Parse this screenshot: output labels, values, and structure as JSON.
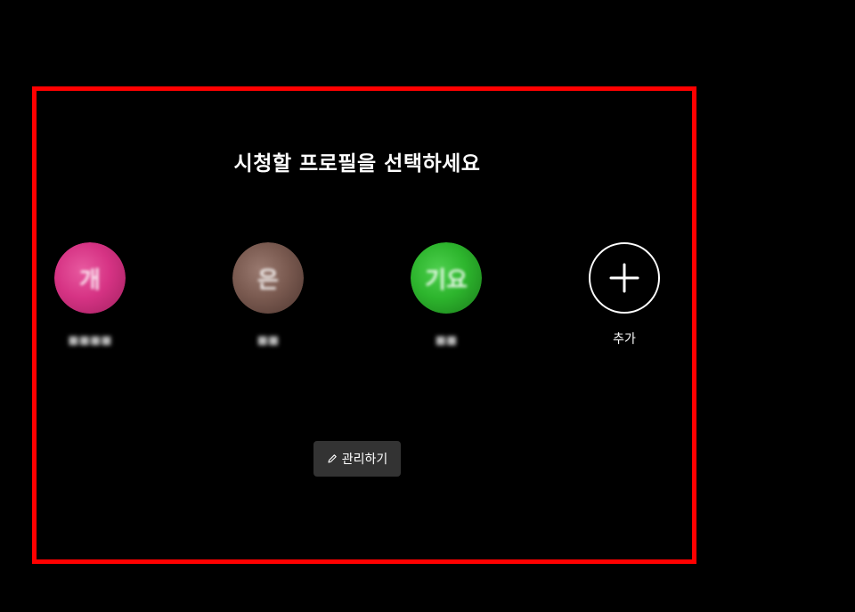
{
  "page": {
    "title": "시청할 프로필을 선택하세요"
  },
  "profiles": [
    {
      "name": "■■■■",
      "glyph": "개",
      "color": "#d63384",
      "color_dark": "#a0205f",
      "icon": "profile-avatar-icon"
    },
    {
      "name": "■■",
      "glyph": "은",
      "color": "#7a5a50",
      "color_dark": "#4e3630",
      "icon": "profile-avatar-icon"
    },
    {
      "name": "■■",
      "glyph": "기요",
      "color": "#2db52d",
      "color_dark": "#1a7a1a",
      "icon": "profile-avatar-icon"
    }
  ],
  "add_profile": {
    "label": "추가",
    "icon": "plus-icon"
  },
  "manage": {
    "label": "관리하기",
    "icon": "pencil-icon"
  },
  "colors": {
    "background": "#000000",
    "highlight": "#ff0000",
    "button_bg": "#333333"
  }
}
